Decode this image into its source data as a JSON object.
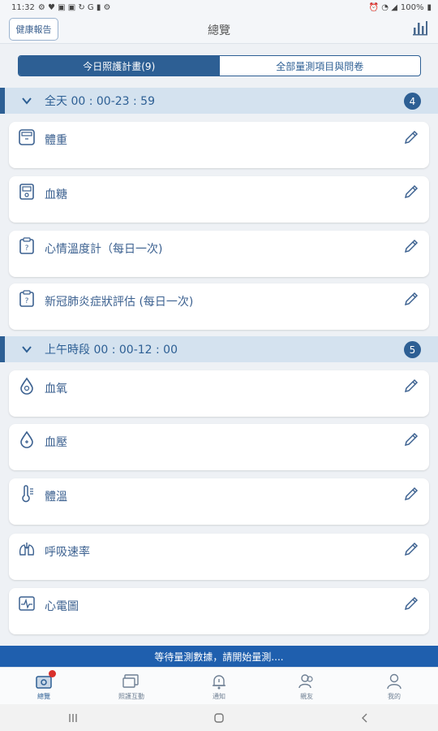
{
  "status": {
    "time": "11:32",
    "battery": "100%"
  },
  "header": {
    "report_label": "健康報告",
    "title": "總覽"
  },
  "segments": [
    {
      "label": "今日照護計畫(9)"
    },
    {
      "label": "全部量測項目與問卷"
    }
  ],
  "sections": [
    {
      "label": "全天 00 : 00-23 : 59",
      "count": "4",
      "items": [
        {
          "name": "體重",
          "icon": "scale-icon"
        },
        {
          "name": "血糖",
          "icon": "glucose-meter-icon"
        },
        {
          "name": "心情溫度計（每日一次)",
          "icon": "questionnaire-icon"
        },
        {
          "name": "新冠肺炎症狀評估 (每日一次)",
          "icon": "questionnaire-icon"
        }
      ]
    },
    {
      "label": "上午時段 00 : 00-12 : 00",
      "count": "5",
      "items": [
        {
          "name": "血氧",
          "icon": "blood-drop-icon"
        },
        {
          "name": "血壓",
          "icon": "blood-drop-icon"
        },
        {
          "name": "體溫",
          "icon": "thermometer-icon"
        },
        {
          "name": "呼吸速率",
          "icon": "lungs-icon"
        },
        {
          "name": "心電圖",
          "icon": "ecg-icon"
        }
      ]
    }
  ],
  "banner": "等待量測數據，請開始量測....",
  "tabs": [
    {
      "label": "總覽"
    },
    {
      "label": "照護互動"
    },
    {
      "label": "通知"
    },
    {
      "label": "親友"
    },
    {
      "label": "我的"
    }
  ],
  "colors": {
    "primary": "#2d5f94",
    "banner": "#1f5fae",
    "badge": "#d9302c"
  }
}
